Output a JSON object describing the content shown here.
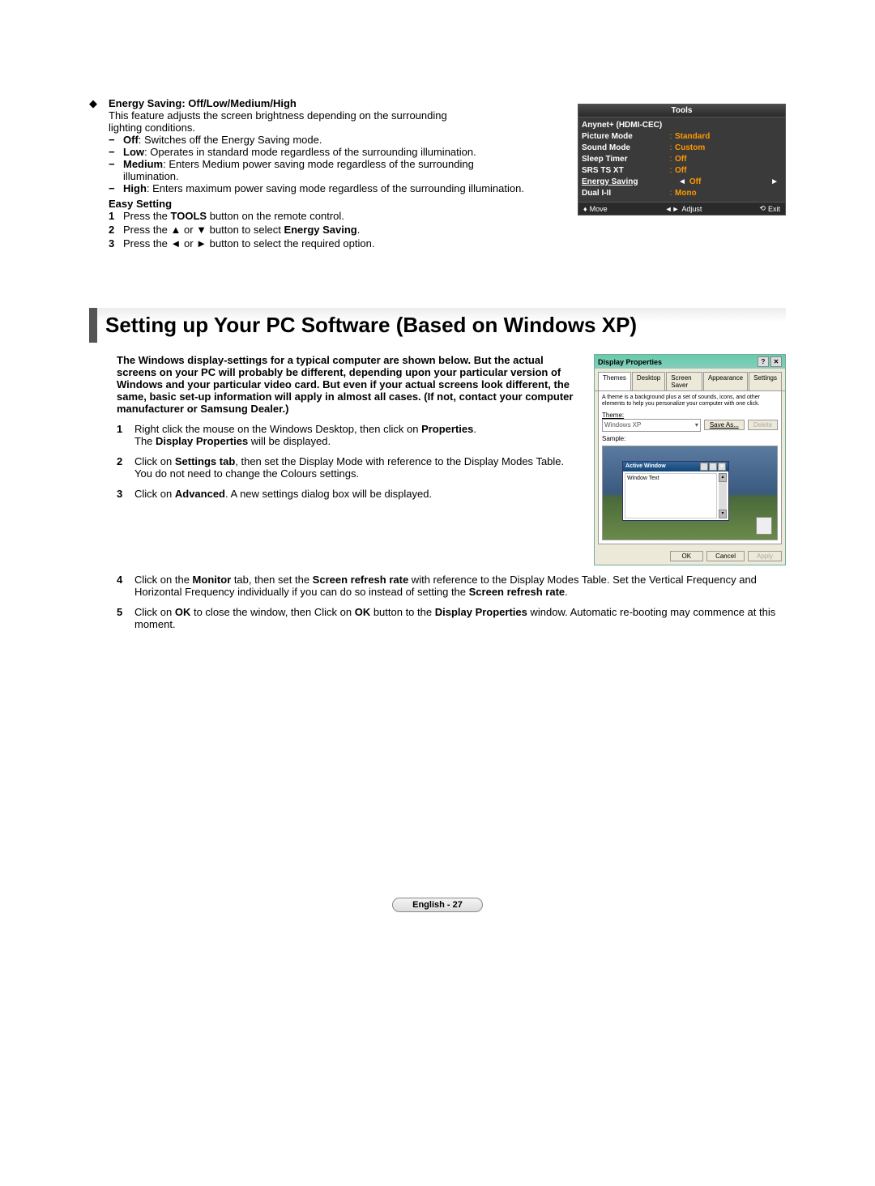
{
  "energy": {
    "title": "Energy Saving",
    "options": "Off/Low/Medium/High",
    "desc1": "This feature adjusts the screen brightness depending on the surrounding lighting conditions.",
    "off_label": "Off",
    "off_desc": ": Switches off the Energy Saving mode.",
    "low_label": "Low",
    "low_desc": ": Operates in standard mode regardless of the surrounding illumination.",
    "med_label": "Medium",
    "med_desc": ": Enters Medium power saving mode regardless of the surrounding illumination.",
    "high_label": "High",
    "high_desc": ": Enters maximum power saving mode regardless of the surrounding illumination.",
    "easy_title": "Easy Setting",
    "step1a": "Press the ",
    "step1b": "TOOLS",
    "step1c": " button on the remote control.",
    "step2a": "Press the ▲ or ▼ button to select ",
    "step2b": "Energy Saving",
    "step2c": ".",
    "step3": "Press the ◄ or ► button to select the required option."
  },
  "osd": {
    "title": "Tools",
    "rows": [
      {
        "label": "Anynet+ (HDMI-CEC)",
        "value": ""
      },
      {
        "label": "Picture Mode",
        "value": "Standard"
      },
      {
        "label": "Sound Mode",
        "value": "Custom"
      },
      {
        "label": "Sleep Timer",
        "value": "Off"
      },
      {
        "label": "SRS TS XT",
        "value": "Off"
      },
      {
        "label": "Energy Saving",
        "value": "Off",
        "selected": true
      },
      {
        "label": "Dual I-II",
        "value": "Mono"
      }
    ],
    "footer": {
      "move": "Move",
      "adjust": "Adjust",
      "exit": "Exit"
    }
  },
  "heading": "Setting up Your PC Software (Based on Windows XP)",
  "intro": "The Windows display-settings for a typical computer are shown below. But the actual screens on your PC will probably be different, depending upon your particular version of Windows and your particular video card. But even if your actual screens look different, the same, basic set-up information will apply in almost all cases. (If not, contact your computer manufacturer or Samsung Dealer.)",
  "steps": {
    "s1a": "Right click the mouse on the Windows Desktop, then click on ",
    "s1b": "Properties",
    "s1c": ".",
    "s1d": "The ",
    "s1e": "Display Properties",
    "s1f": " will be displayed.",
    "s2a": "Click on ",
    "s2b": "Settings tab",
    "s2c": ", then set the Display Mode with reference to the Display Modes Table. You do not need to change the Colours settings.",
    "s3a": "Click on ",
    "s3b": "Advanced",
    "s3c": ". A new settings dialog box will be displayed.",
    "s4a": "Click on the ",
    "s4b": "Monitor",
    "s4c": " tab, then set the ",
    "s4d": "Screen refresh rate",
    "s4e": " with reference to the Display Modes Table. Set the Vertical Frequency and Horizontal Frequency individually if you can do so instead of setting the ",
    "s4f": "Screen refresh rate",
    "s4g": ".",
    "s5a": "Click on ",
    "s5b": "OK",
    "s5c": " to close the window, then Click on ",
    "s5d": "OK",
    "s5e": " button to the ",
    "s5f": "Display Properties",
    "s5g": " window. Automatic re-booting may commence at this moment."
  },
  "dp": {
    "title": "Display Properties",
    "tabs": [
      "Themes",
      "Desktop",
      "Screen Saver",
      "Appearance",
      "Settings"
    ],
    "desc": "A theme is a background plus a set of sounds, icons, and other elements to help you personalize your computer with one click.",
    "theme_label": "Theme:",
    "theme_value": "Windows XP",
    "save_as": "Save As...",
    "delete": "Delete",
    "sample_label": "Sample:",
    "active_window": "Active Window",
    "window_text": "Window Text",
    "ok": "OK",
    "cancel": "Cancel",
    "apply": "Apply"
  },
  "page_label": "English - 27"
}
